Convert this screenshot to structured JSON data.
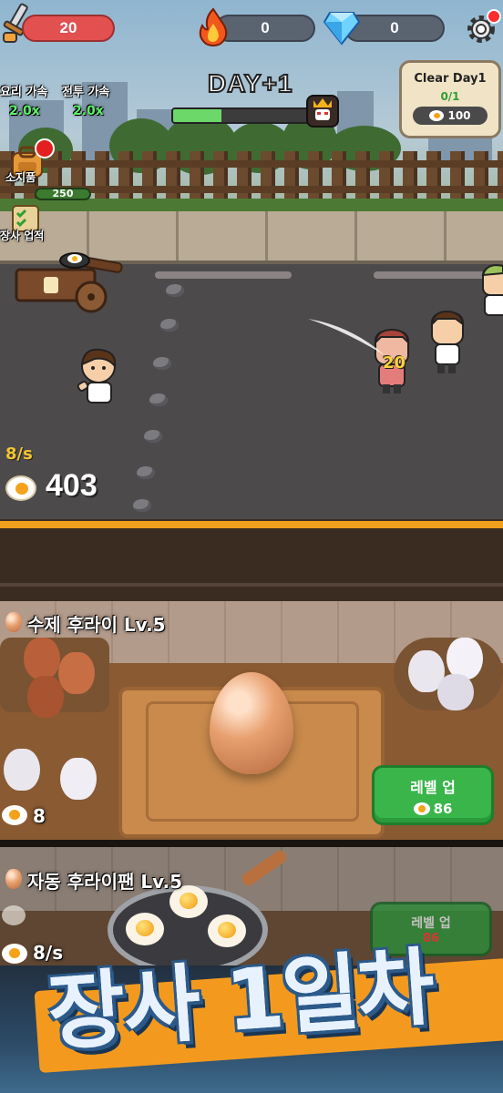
{
  "hud": {
    "attack_value": "20",
    "fire_value": "0",
    "gem_value": "0",
    "settings_icon": "gear-icon",
    "attack_icon": "sword-icon",
    "fire_icon": "fire-icon",
    "gem_icon": "diamond-icon"
  },
  "boosts": {
    "cooking": {
      "label": "요리 가속",
      "value": "2.0x"
    },
    "battle": {
      "label": "전투 가속",
      "value": "2.0x"
    }
  },
  "day": {
    "title": "DAY+1",
    "progress": 0.35
  },
  "clear": {
    "title": "Clear Day1",
    "progress": "0/1",
    "reward": "100"
  },
  "side_buttons": {
    "inventory": {
      "label": "소지품",
      "count": "250"
    },
    "achievements": {
      "label": "장사 업적"
    }
  },
  "scene": {
    "damage_text": "20"
  },
  "stats": {
    "rate": "8/s",
    "egg_total": "403"
  },
  "manual": {
    "title": "수제 후라이 Lv.5",
    "tap_value": "8",
    "level_up_label": "레벨 업",
    "level_up_cost": "86"
  },
  "auto": {
    "title": "자동 후라이팬 Lv.5",
    "rate": "8/s",
    "level_up_label": "레벨 업",
    "level_up_cost": "86"
  },
  "promo": {
    "text": "장사 1일차"
  },
  "colors": {
    "accent_orange": "#f19f1d",
    "button_green": "#39b54a",
    "hp_red": "#e35050"
  }
}
